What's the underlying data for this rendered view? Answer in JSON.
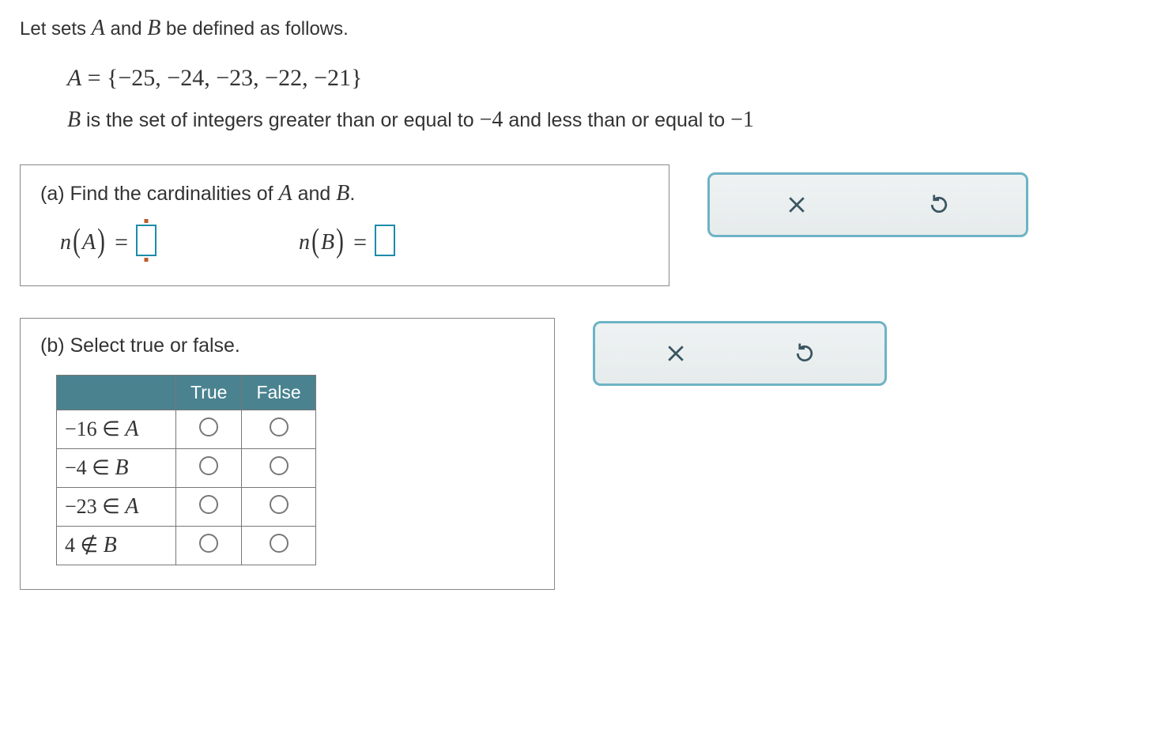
{
  "intro_prefix": "Let sets ",
  "intro_mid": " and ",
  "intro_suffix": " be defined as follows.",
  "setA_lhs": "A",
  "setA_rhs_open": "{",
  "setA_rhs_close": "}",
  "setA_elements": "−25,  −24,  −23,  −22,  −21",
  "setB_prefix": "B",
  "setB_text1": " is the set of integers greater than or equal to ",
  "setB_val1": "−4",
  "setB_text2": " and less than or equal to ",
  "setB_val2": "−1",
  "partA": {
    "label_prefix": "(a)  Find the cardinalities of ",
    "label_mid": " and ",
    "label_suffix": ".",
    "nA_label": "n",
    "A": "A",
    "B": "B",
    "equals": "="
  },
  "partB": {
    "label": "(b)  Select true or false.",
    "col_true": "True",
    "col_false": "False",
    "rows": [
      {
        "lhs": "−16",
        "rel": "∈",
        "rhs": "A"
      },
      {
        "lhs": "−4",
        "rel": "∈",
        "rhs": "B"
      },
      {
        "lhs": "−23",
        "rel": "∈",
        "rhs": "A"
      },
      {
        "lhs": "4",
        "rel": "∉",
        "rhs": "B"
      }
    ]
  }
}
